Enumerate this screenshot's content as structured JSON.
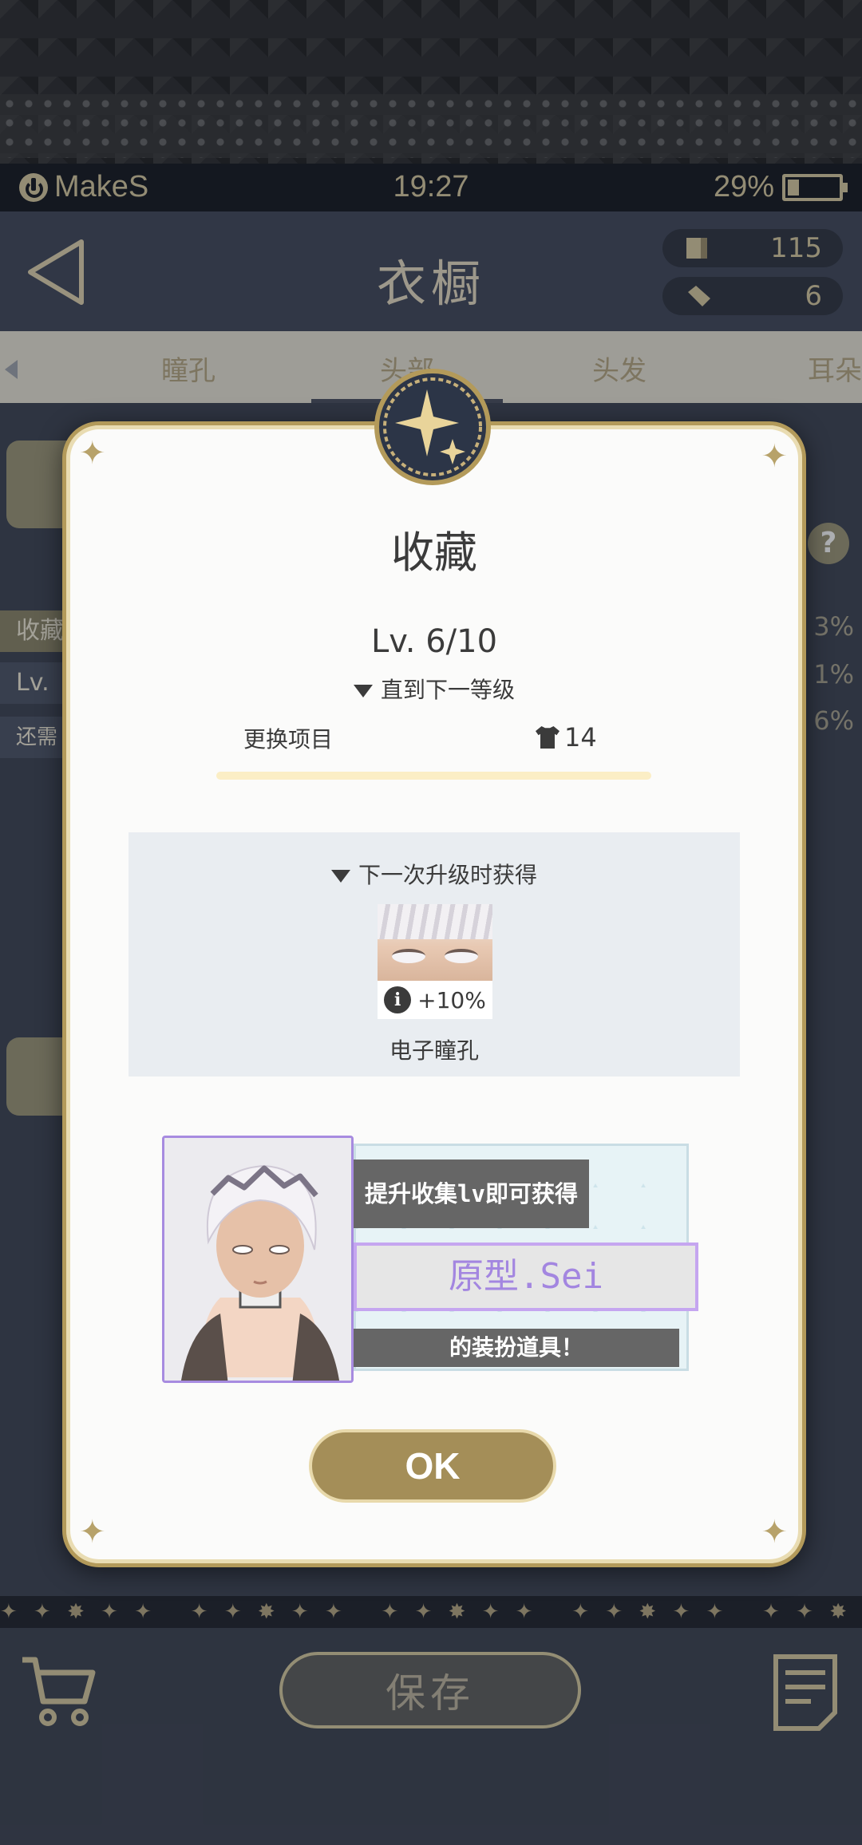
{
  "status": {
    "carrier": "MakeS",
    "time": "19:27",
    "battery": "29%",
    "battery_level": 0.29
  },
  "header": {
    "title": "衣橱",
    "currency_1": "115",
    "currency_2": "6"
  },
  "tabs": [
    {
      "label": "瞳孔"
    },
    {
      "label": "头部",
      "active": true
    },
    {
      "label": "头发"
    },
    {
      "label": "耳朵"
    }
  ],
  "background": {
    "row1": "收藏",
    "row2": "Lv.",
    "row3": "还需",
    "pct1": "3%",
    "pct2": "1%",
    "pct3": "6%",
    "help": "?"
  },
  "modal": {
    "title": "收藏",
    "level": "Lv. 6/10",
    "next_label": "直到下一等级",
    "swap_label": "更换项目",
    "swap_count": "14",
    "progress": 0.0,
    "reward_title": "下一次升级时获得",
    "reward_bonus": "+10%",
    "reward_name": "电子瞳孔",
    "promo_line1": "提升收集lv即可获得",
    "promo_name": "原型.Sei",
    "promo_line3": "的装扮道具！",
    "ok": "OK"
  },
  "bottom": {
    "save": "保存"
  },
  "colors": {
    "gold": "#b39a5a",
    "purple": "#a386e0",
    "dark": "#3e4454"
  }
}
